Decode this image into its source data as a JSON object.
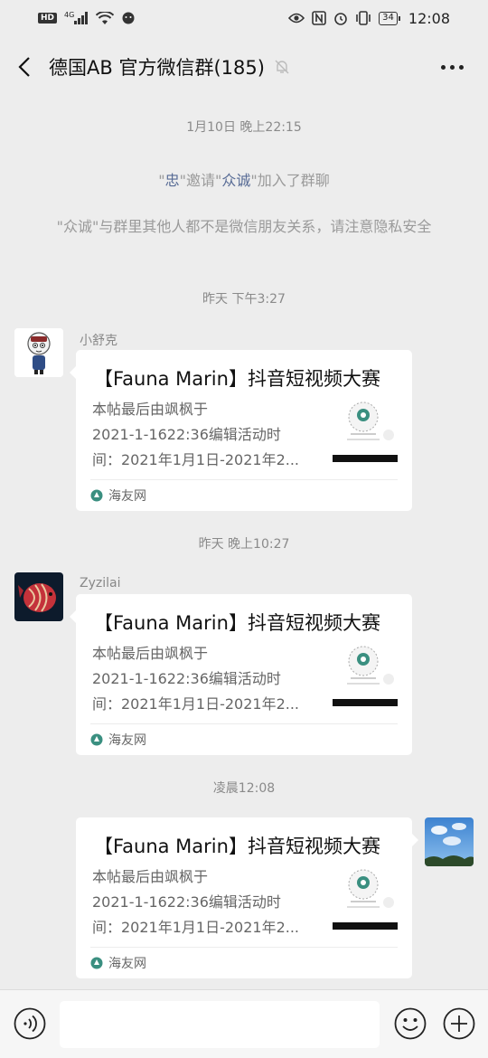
{
  "status_bar": {
    "hd": "HD",
    "network": "4G",
    "battery": "34",
    "time": "12:08"
  },
  "nav": {
    "title": "德国AB  官方微信群(185)"
  },
  "chat": {
    "time_1": "1月10日 晚上22:15",
    "system_invite": {
      "q1": "\"",
      "inviter": "忠",
      "mid": "\"邀请\"",
      "invitee": "众诚",
      "end": "\"加入了群聊"
    },
    "system_privacy": "\"众诚\"与群里其他人都不是微信朋友关系，请注意隐私安全",
    "time_2": "昨天 下午3:27",
    "msg_1": {
      "sender": "小舒克",
      "title": "【Fauna Marin】抖音短视频大赛",
      "desc_lines": [
        "本帖最后由飒枫于",
        "2021-1-1622:36编辑活动时",
        "间：2021年1月1日-2021年2..."
      ],
      "source": "海友网"
    },
    "time_3": "昨天 晚上10:27",
    "msg_2": {
      "sender": "Zyzilai",
      "title": "【Fauna Marin】抖音短视频大赛",
      "desc_lines": [
        "本帖最后由飒枫于",
        "2021-1-1622:36编辑活动时",
        "间：2021年1月1日-2021年2..."
      ],
      "source": "海友网"
    },
    "time_4": "凌晨12:08",
    "msg_3": {
      "title": "【Fauna Marin】抖音短视频大赛",
      "desc_lines": [
        "本帖最后由飒枫于",
        "2021-1-1622:36编辑活动时",
        "间：2021年1月1日-2021年2..."
      ],
      "source": "海友网"
    }
  },
  "input_bar": {
    "placeholder": ""
  },
  "icons": {
    "back": "chevron-left-icon",
    "mute": "mute-bell-icon",
    "more": "more-dots-icon",
    "voice": "voice-icon",
    "emoji": "emoji-icon",
    "plus": "plus-icon"
  },
  "colors": {
    "link": "#576b95",
    "background": "#ededed",
    "source_icon": "#3a8f80"
  }
}
